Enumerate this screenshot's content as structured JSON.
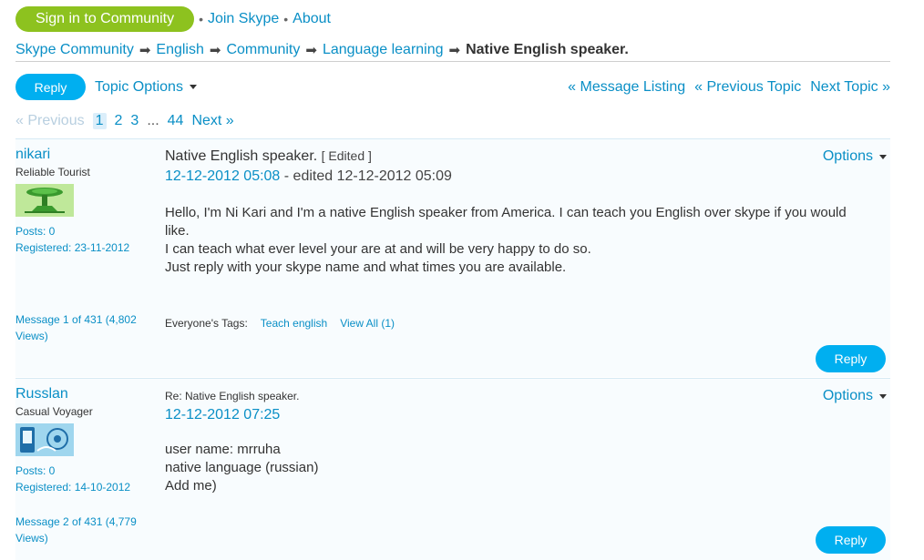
{
  "topbar": {
    "signin_label": "Sign in to Community",
    "separator": "•",
    "join_label": "Join Skype",
    "about_label": "About"
  },
  "breadcrumb": {
    "items": [
      "Skype Community",
      "English",
      "Community",
      "Language learning"
    ],
    "arrow": "➡",
    "current": "Native English speaker."
  },
  "actions": {
    "reply_label": "Reply",
    "topic_options_label": "Topic Options",
    "message_listing": "« Message Listing",
    "previous_topic": "« Previous Topic",
    "next_topic": "Next Topic »"
  },
  "pager": {
    "previous": "« Previous",
    "pages": [
      "1",
      "2",
      "3"
    ],
    "ellipsis": "...",
    "last_page": "44",
    "next": "Next »"
  },
  "messages": [
    {
      "author": "nikari",
      "rank": "Reliable Tourist",
      "posts": "Posts: 0",
      "registered": "Registered: 23-11-2012",
      "subject": "Native English speaker.",
      "edited_tag": "[ Edited ]",
      "date": "12-12-2012 05:08",
      "edited_info": " - edited 12-12-2012 05:09",
      "body": [
        "Hello, I'm Ni Kari and I'm a native English speaker from America. I can teach you English over skype if you would",
        "like.",
        "I can teach what ever level your are at and will be very happy to do so.",
        "Just reply with your skype name and what times you are available."
      ],
      "count_line1": "Message 1 of 431 (4,802",
      "count_line2": "Views)",
      "tags_label": "Everyone's Tags:",
      "tag": "Teach english",
      "view_all": "View All (1)",
      "options_label": "Options",
      "reply_label": "Reply"
    },
    {
      "author": "Russlan",
      "rank": "Casual Voyager",
      "posts": "Posts: 0",
      "registered": "Registered: 14-10-2012",
      "subject": "Re: Native English speaker.",
      "date": "12-12-2012 07:25",
      "body": [
        "user name: mrruha",
        "native language (russian)",
        "Add me)"
      ],
      "count_line1": "Message 2 of 431 (4,779",
      "count_line2": "Views)",
      "options_label": "Options",
      "reply_label": "Reply"
    }
  ],
  "colors": {
    "accent": "#0a8fc6",
    "reply_button": "#00aff0",
    "signin_button": "#8dc21f"
  }
}
